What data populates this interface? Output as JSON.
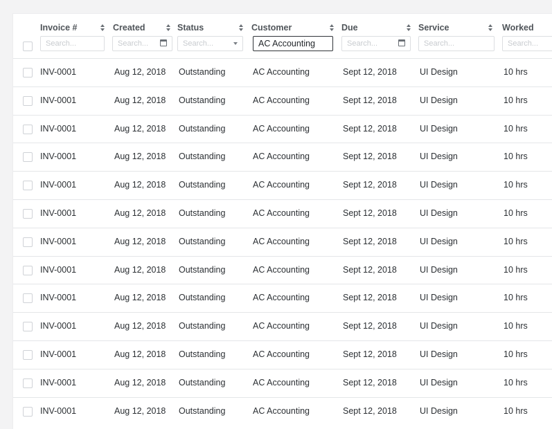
{
  "columns": [
    {
      "label": "Invoice #",
      "placeholder": "Search...",
      "value": ""
    },
    {
      "label": "Created",
      "placeholder": "Search...",
      "value": ""
    },
    {
      "label": "Status",
      "placeholder": "Search...",
      "value": ""
    },
    {
      "label": "Customer",
      "placeholder": "",
      "value": "AC Accounting"
    },
    {
      "label": "Due",
      "placeholder": "Search...",
      "value": ""
    },
    {
      "label": "Service",
      "placeholder": "Search...",
      "value": ""
    },
    {
      "label": "Worked",
      "placeholder": "Search...",
      "value": ""
    }
  ],
  "icons": {
    "sort": "sort-icon",
    "calendar": "calendar-icon",
    "dropdown": "chevron-down-icon"
  },
  "rows": [
    {
      "invoice": "INV-0001",
      "created": "Aug 12, 2018",
      "status": "Outstanding",
      "customer": "AC Accounting",
      "due": "Sept 12, 2018",
      "service": "UI Design",
      "worked": "10 hrs"
    },
    {
      "invoice": "INV-0001",
      "created": "Aug 12, 2018",
      "status": "Outstanding",
      "customer": "AC Accounting",
      "due": "Sept 12, 2018",
      "service": "UI Design",
      "worked": "10 hrs"
    },
    {
      "invoice": "INV-0001",
      "created": "Aug 12, 2018",
      "status": "Outstanding",
      "customer": "AC Accounting",
      "due": "Sept 12, 2018",
      "service": "UI Design",
      "worked": "10 hrs"
    },
    {
      "invoice": "INV-0001",
      "created": "Aug 12, 2018",
      "status": "Outstanding",
      "customer": "AC Accounting",
      "due": "Sept 12, 2018",
      "service": "UI Design",
      "worked": "10 hrs"
    },
    {
      "invoice": "INV-0001",
      "created": "Aug 12, 2018",
      "status": "Outstanding",
      "customer": "AC Accounting",
      "due": "Sept 12, 2018",
      "service": "UI Design",
      "worked": "10 hrs"
    },
    {
      "invoice": "INV-0001",
      "created": "Aug 12, 2018",
      "status": "Outstanding",
      "customer": "AC Accounting",
      "due": "Sept 12, 2018",
      "service": "UI Design",
      "worked": "10 hrs"
    },
    {
      "invoice": "INV-0001",
      "created": "Aug 12, 2018",
      "status": "Outstanding",
      "customer": "AC Accounting",
      "due": "Sept 12, 2018",
      "service": "UI Design",
      "worked": "10 hrs"
    },
    {
      "invoice": "INV-0001",
      "created": "Aug 12, 2018",
      "status": "Outstanding",
      "customer": "AC Accounting",
      "due": "Sept 12, 2018",
      "service": "UI Design",
      "worked": "10 hrs"
    },
    {
      "invoice": "INV-0001",
      "created": "Aug 12, 2018",
      "status": "Outstanding",
      "customer": "AC Accounting",
      "due": "Sept 12, 2018",
      "service": "UI Design",
      "worked": "10 hrs"
    },
    {
      "invoice": "INV-0001",
      "created": "Aug 12, 2018",
      "status": "Outstanding",
      "customer": "AC Accounting",
      "due": "Sept 12, 2018",
      "service": "UI Design",
      "worked": "10 hrs"
    },
    {
      "invoice": "INV-0001",
      "created": "Aug 12, 2018",
      "status": "Outstanding",
      "customer": "AC Accounting",
      "due": "Sept 12, 2018",
      "service": "UI Design",
      "worked": "10 hrs"
    },
    {
      "invoice": "INV-0001",
      "created": "Aug 12, 2018",
      "status": "Outstanding",
      "customer": "AC Accounting",
      "due": "Sept 12, 2018",
      "service": "UI Design",
      "worked": "10 hrs"
    },
    {
      "invoice": "INV-0001",
      "created": "Aug 12, 2018",
      "status": "Outstanding",
      "customer": "AC Accounting",
      "due": "Sept 12, 2018",
      "service": "UI Design",
      "worked": "10 hrs"
    }
  ]
}
